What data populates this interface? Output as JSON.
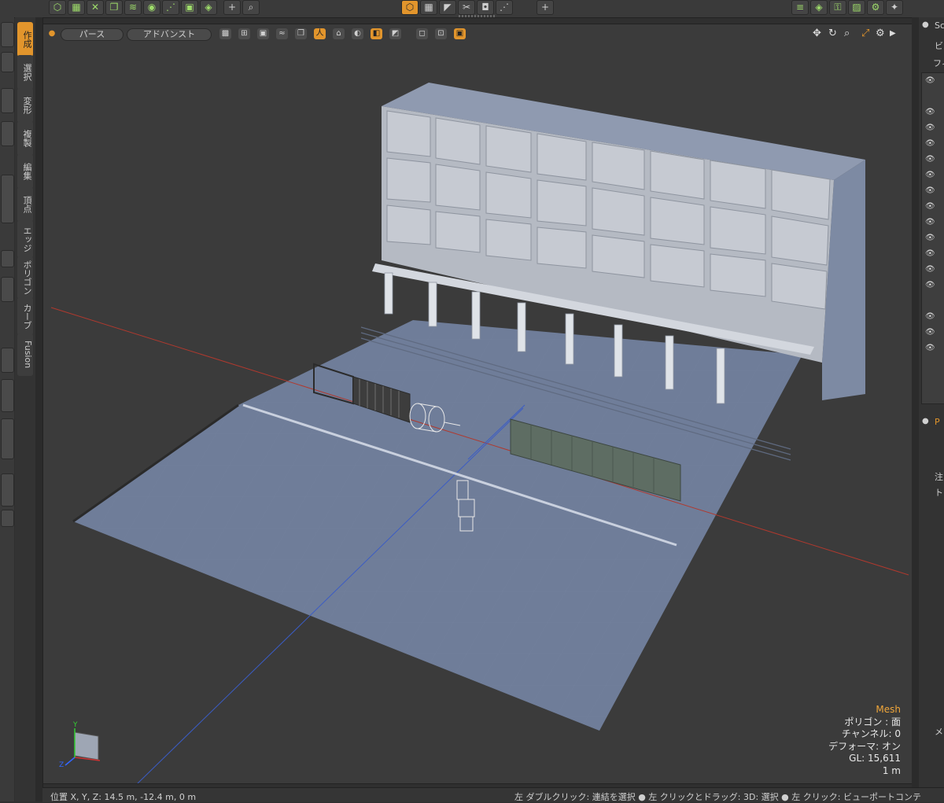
{
  "toolbar": {
    "left_icons": [
      "cube-icon",
      "grid-cube-icon",
      "cross-icon",
      "copy-icon",
      "spiral-icon",
      "sphere-icon",
      "dotted-icon",
      "box-icon",
      "shield-icon",
      "plus-icon",
      "magnify-icon"
    ],
    "center_icons": [
      "cube-orange-icon",
      "grid-icon",
      "cursor-icon",
      "scissors-icon",
      "camera-icon",
      "dotted-icon",
      "plus-icon"
    ],
    "right_icons": [
      "list-icon",
      "layers-icon",
      "render-icon",
      "image-icon",
      "settings-icon",
      "star-icon"
    ]
  },
  "left_tabs": [
    "作成",
    "選択",
    "変形",
    "複製",
    "編集",
    "頂点",
    "エッジ",
    "ポリゴン",
    "カーブ",
    "Fusion"
  ],
  "viewport": {
    "view_mode": "パース",
    "shading_mode": "アドバンスト",
    "nav_icons": [
      "move-icon",
      "rotate-icon",
      "zoom-icon",
      "maximize-icon",
      "settings-icon",
      "menu-arrow-icon"
    ],
    "info": {
      "title": "Mesh",
      "polygon": "ポリゴン : 面",
      "channel": "チャンネル: 0",
      "deformer": "デフォーマ: オン",
      "gl": "GL: 15,611",
      "scale": "1 m"
    },
    "axis_labels": {
      "y": "Y",
      "z": "Z"
    }
  },
  "right_panel": {
    "header": "Sc",
    "tab": "ビ",
    "filter": "フィルタ",
    "panel2": "P",
    "item_a": "注",
    "item_b": "ト",
    "item_c": "メ"
  },
  "status": {
    "position": "位置 X, Y, Z:   14.5 m, -12.4 m, 0 m",
    "help": "左 ダブルクリック: 連結を選択 ● 左 クリックとドラッグ: 3D: 選択 ● 左 クリック: ビューポートコンテ"
  },
  "colors": {
    "accent": "#e2952c",
    "ground": "#6f7d99",
    "building": "#b7bcc6",
    "x_axis": "#b0392e",
    "y_axis": "#3b5cc4"
  }
}
